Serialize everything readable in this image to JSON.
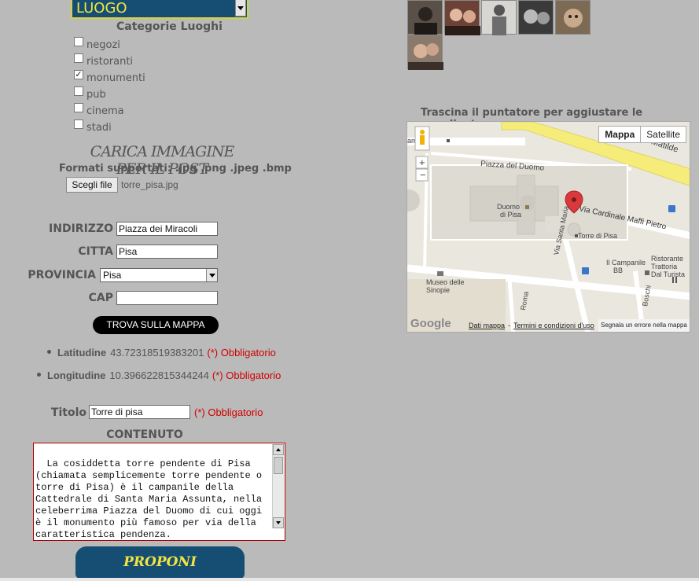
{
  "type_select": {
    "value": "LUOGO"
  },
  "categories": {
    "title": "Categorie Luoghi",
    "items": [
      {
        "label": "negozi",
        "checked": false
      },
      {
        "label": "ristoranti",
        "checked": false
      },
      {
        "label": "monumenti",
        "checked": true
      },
      {
        "label": "pub",
        "checked": false
      },
      {
        "label": "cinema",
        "checked": false
      },
      {
        "label": "stadi",
        "checked": false
      }
    ]
  },
  "upload": {
    "title": "CARICA IMMAGINE PER IL POST",
    "formats": "Formati supportati: .jpg .png .jpeg .bmp",
    "button": "Scegli file",
    "filename": "torre_pisa.jpg"
  },
  "address": {
    "indirizzo_label": "INDIRIZZO",
    "indirizzo_value": "Piazza dei Miracoli",
    "citta_label": "CITTA",
    "citta_value": "Pisa",
    "provincia_label": "PROVINCIA",
    "provincia_value": "Pisa",
    "cap_label": "CAP",
    "cap_value": ""
  },
  "find_button": "TROVA SULLA MAPPA",
  "coords": {
    "lat_label": "Latitudine",
    "lat_value": "43.72318519383201",
    "lon_label": "Longitudine",
    "lon_value": "10.396622815344244",
    "required": "(*) Obbligatorio"
  },
  "title_field": {
    "label": "Titolo",
    "value": "Torre di pisa",
    "required": "(*) Obbligatorio"
  },
  "content": {
    "label": "CONTENUTO",
    "text": "La cosiddetta torre pendente di Pisa (chiamata semplicemente torre pendente o torre di Pisa) è il campanile della Cattedrale di Santa Maria Assunta, nella celeberrima Piazza del Duomo di cui oggi è il monumento più famoso per via della caratteristica pendenza.\nSi tratta di un campanile a sé stante alto"
  },
  "submit": "PROPONI",
  "map": {
    "caption": "Trascina il puntatore per aggiustare le coordinate",
    "type_map": "Mappa",
    "type_satellite": "Satellite",
    "labels": {
      "piazza": "Piazza del Duomo",
      "duomo": "Duomo\ndi Pisa",
      "via_cardinale": "Via Cardinale Maffi Pietro",
      "via_santa_maria": "Via Santa Maria",
      "torre": "Torre di Pisa",
      "campanile": "Il Campanile\nBB",
      "ristorante": "Ristorante\nTrattoria\nDal Turista",
      "museo": "Museo delle\nSinopie",
      "contessa": "ontessa Matilde",
      "roma": "Roma",
      "boschi": "Boschi"
    },
    "footer": {
      "google": "Google",
      "dati": "Dati mappa",
      "termini": "Termini e condizioni d'uso",
      "segnala": "Segnala un errore nella mappa"
    },
    "colors": {
      "road": "#ffffff",
      "main_road": "#f6ec7a",
      "marker": "#d9393d"
    }
  },
  "avatars": [
    {
      "name": "avatar-1",
      "bg": "#5a5048"
    },
    {
      "name": "avatar-2",
      "bg": "#6b4235"
    },
    {
      "name": "avatar-3",
      "bg": "#d8d6d2"
    },
    {
      "name": "avatar-4",
      "bg": "#3a3a3a"
    },
    {
      "name": "avatar-5",
      "bg": "#7d6a55"
    },
    {
      "name": "avatar-6",
      "bg": "#8a7a6e"
    }
  ]
}
